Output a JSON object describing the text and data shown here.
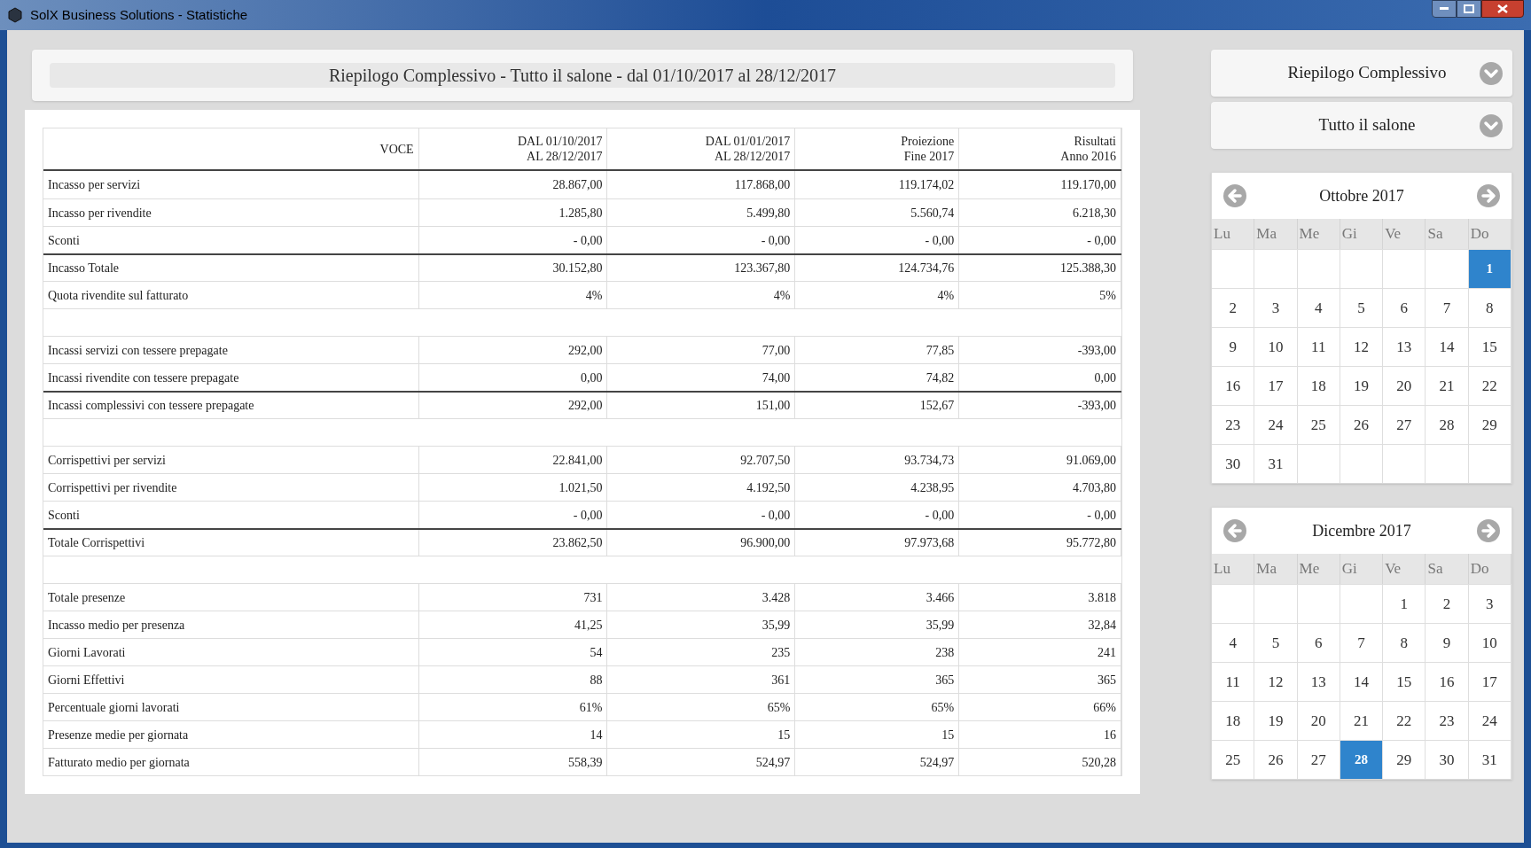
{
  "window": {
    "title": "SolX Business Solutions - Statistiche"
  },
  "report_title": "Riepilogo Complessivo - Tutto il salone - dal 01/10/2017 al 28/12/2017",
  "table": {
    "columns": [
      [
        "VOCE"
      ],
      [
        "DAL 01/10/2017",
        "AL 28/12/2017"
      ],
      [
        "DAL 01/01/2017",
        "AL 28/12/2017"
      ],
      [
        "Proiezione",
        "Fine 2017"
      ],
      [
        "Risultati",
        "Anno 2016"
      ]
    ],
    "rows": [
      {
        "kind": "data",
        "cells": [
          "Incasso per servizi",
          "28.867,00",
          "117.868,00",
          "119.174,02",
          "119.170,00"
        ]
      },
      {
        "kind": "data",
        "cells": [
          "Incasso per rivendite",
          "1.285,80",
          "5.499,80",
          "5.560,74",
          "6.218,30"
        ]
      },
      {
        "kind": "data",
        "cells": [
          "Sconti",
          "- 0,00",
          "- 0,00",
          "- 0,00",
          "- 0,00"
        ]
      },
      {
        "kind": "total",
        "cells": [
          "Incasso Totale",
          "30.152,80",
          "123.367,80",
          "124.734,76",
          "125.388,30"
        ]
      },
      {
        "kind": "data",
        "cells": [
          "Quota rivendite sul fatturato",
          "4%",
          "4%",
          "4%",
          "5%"
        ]
      },
      {
        "kind": "blank"
      },
      {
        "kind": "data",
        "cells": [
          "Incassi servizi con tessere prepagate",
          "292,00",
          "77,00",
          "77,85",
          "-393,00"
        ]
      },
      {
        "kind": "data",
        "cells": [
          "Incassi rivendite con tessere prepagate",
          "0,00",
          "74,00",
          "74,82",
          "0,00"
        ]
      },
      {
        "kind": "total",
        "cells": [
          "Incassi complessivi con tessere prepagate",
          "292,00",
          "151,00",
          "152,67",
          "-393,00"
        ]
      },
      {
        "kind": "blank"
      },
      {
        "kind": "data",
        "cells": [
          "Corrispettivi per servizi",
          "22.841,00",
          "92.707,50",
          "93.734,73",
          "91.069,00"
        ]
      },
      {
        "kind": "data",
        "cells": [
          "Corrispettivi per rivendite",
          "1.021,50",
          "4.192,50",
          "4.238,95",
          "4.703,80"
        ]
      },
      {
        "kind": "data",
        "cells": [
          "Sconti",
          "- 0,00",
          "- 0,00",
          "- 0,00",
          "- 0,00"
        ]
      },
      {
        "kind": "total",
        "cells": [
          "Totale Corrispettivi",
          "23.862,50",
          "96.900,00",
          "97.973,68",
          "95.772,80"
        ]
      },
      {
        "kind": "blank"
      },
      {
        "kind": "data",
        "cells": [
          "Totale presenze",
          "731",
          "3.428",
          "3.466",
          "3.818"
        ]
      },
      {
        "kind": "data",
        "cells": [
          "Incasso medio per presenza",
          "41,25",
          "35,99",
          "35,99",
          "32,84"
        ]
      },
      {
        "kind": "data",
        "cells": [
          "Giorni Lavorati",
          "54",
          "235",
          "238",
          "241"
        ]
      },
      {
        "kind": "data",
        "cells": [
          "Giorni Effettivi",
          "88",
          "361",
          "365",
          "365"
        ]
      },
      {
        "kind": "data",
        "cells": [
          "Percentuale giorni lavorati",
          "61%",
          "65%",
          "65%",
          "66%"
        ]
      },
      {
        "kind": "data",
        "cells": [
          "Presenze medie per giornata",
          "14",
          "15",
          "15",
          "16"
        ]
      },
      {
        "kind": "data",
        "cells": [
          "Fatturato medio per giornata",
          "558,39",
          "524,97",
          "524,97",
          "520,28"
        ]
      }
    ]
  },
  "selectors": [
    {
      "value": "Riepilogo Complessivo"
    },
    {
      "value": "Tutto il salone"
    }
  ],
  "calendars": [
    {
      "month": "Ottobre 2017",
      "weekdays": [
        "Lu",
        "Ma",
        "Me",
        "Gi",
        "Ve",
        "Sa",
        "Do"
      ],
      "weeks": [
        [
          {
            "kind": "blank"
          },
          {
            "kind": "blank"
          },
          {
            "kind": "blank"
          },
          {
            "kind": "blank"
          },
          {
            "kind": "blank"
          },
          {
            "kind": "blank"
          },
          {
            "day": "1",
            "selected": true
          }
        ],
        [
          {
            "day": "2",
            "selected": false
          },
          {
            "day": "3",
            "selected": false
          },
          {
            "day": "4",
            "selected": false
          },
          {
            "day": "5",
            "selected": false
          },
          {
            "day": "6",
            "selected": false
          },
          {
            "day": "7",
            "selected": false
          },
          {
            "day": "8",
            "selected": false
          }
        ],
        [
          {
            "day": "9",
            "selected": false
          },
          {
            "day": "10",
            "selected": false
          },
          {
            "day": "11",
            "selected": false
          },
          {
            "day": "12",
            "selected": false
          },
          {
            "day": "13",
            "selected": false
          },
          {
            "day": "14",
            "selected": false
          },
          {
            "day": "15",
            "selected": false
          }
        ],
        [
          {
            "day": "16",
            "selected": false
          },
          {
            "day": "17",
            "selected": false
          },
          {
            "day": "18",
            "selected": false
          },
          {
            "day": "19",
            "selected": false
          },
          {
            "day": "20",
            "selected": false
          },
          {
            "day": "21",
            "selected": false
          },
          {
            "day": "22",
            "selected": false
          }
        ],
        [
          {
            "day": "23",
            "selected": false
          },
          {
            "day": "24",
            "selected": false
          },
          {
            "day": "25",
            "selected": false
          },
          {
            "day": "26",
            "selected": false
          },
          {
            "day": "27",
            "selected": false
          },
          {
            "day": "28",
            "selected": false
          },
          {
            "day": "29",
            "selected": false
          }
        ],
        [
          {
            "day": "30",
            "selected": false
          },
          {
            "day": "31",
            "selected": false
          },
          {
            "kind": "blank"
          },
          {
            "kind": "blank"
          },
          {
            "kind": "blank"
          },
          {
            "kind": "blank"
          },
          {
            "kind": "blank"
          }
        ]
      ]
    },
    {
      "month": "Dicembre 2017",
      "weekdays": [
        "Lu",
        "Ma",
        "Me",
        "Gi",
        "Ve",
        "Sa",
        "Do"
      ],
      "weeks": [
        [
          {
            "kind": "blank"
          },
          {
            "kind": "blank"
          },
          {
            "kind": "blank"
          },
          {
            "kind": "blank"
          },
          {
            "day": "1",
            "selected": false
          },
          {
            "day": "2",
            "selected": false
          },
          {
            "day": "3",
            "selected": false
          }
        ],
        [
          {
            "day": "4",
            "selected": false
          },
          {
            "day": "5",
            "selected": false
          },
          {
            "day": "6",
            "selected": false
          },
          {
            "day": "7",
            "selected": false
          },
          {
            "day": "8",
            "selected": false
          },
          {
            "day": "9",
            "selected": false
          },
          {
            "day": "10",
            "selected": false
          }
        ],
        [
          {
            "day": "11",
            "selected": false
          },
          {
            "day": "12",
            "selected": false
          },
          {
            "day": "13",
            "selected": false
          },
          {
            "day": "14",
            "selected": false
          },
          {
            "day": "15",
            "selected": false
          },
          {
            "day": "16",
            "selected": false
          },
          {
            "day": "17",
            "selected": false
          }
        ],
        [
          {
            "day": "18",
            "selected": false
          },
          {
            "day": "19",
            "selected": false
          },
          {
            "day": "20",
            "selected": false
          },
          {
            "day": "21",
            "selected": false
          },
          {
            "day": "22",
            "selected": false
          },
          {
            "day": "23",
            "selected": false
          },
          {
            "day": "24",
            "selected": false
          }
        ],
        [
          {
            "day": "25",
            "selected": false
          },
          {
            "day": "26",
            "selected": false
          },
          {
            "day": "27",
            "selected": false
          },
          {
            "day": "28",
            "selected": true
          },
          {
            "day": "29",
            "selected": false
          },
          {
            "day": "30",
            "selected": false
          },
          {
            "day": "31",
            "selected": false
          }
        ]
      ]
    }
  ]
}
